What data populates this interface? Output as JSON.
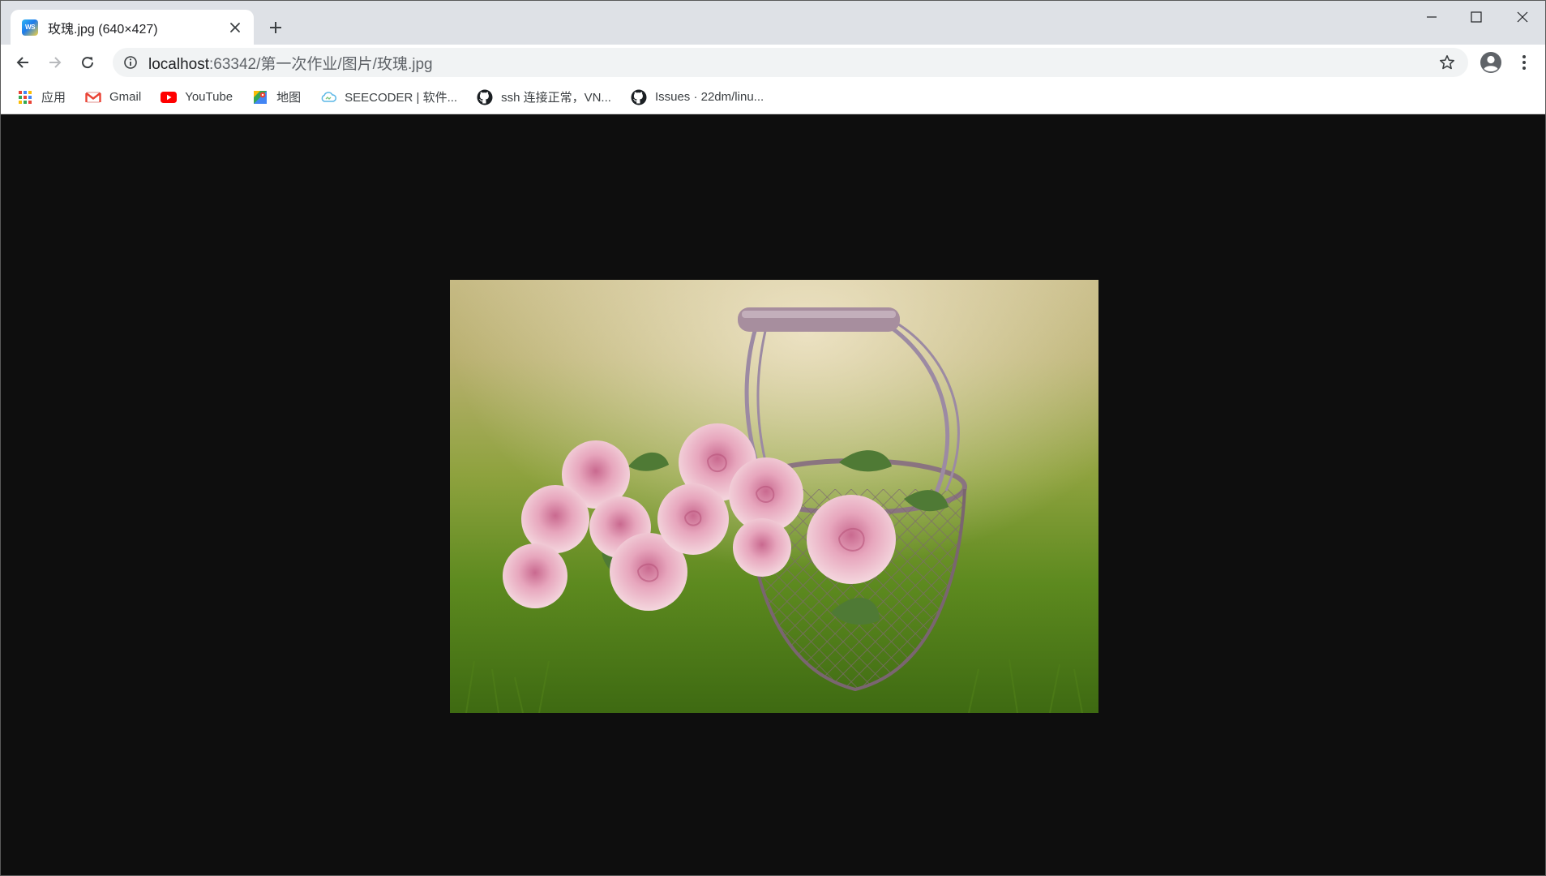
{
  "tab": {
    "title": "玫瑰.jpg (640×427)",
    "favicon": "webstorm-icon"
  },
  "address": {
    "host": "localhost",
    "rest": ":63342/第一次作业/图片/玫瑰.jpg"
  },
  "bookmarks": [
    {
      "label": "应用",
      "icon": "apps-grid-icon"
    },
    {
      "label": "Gmail",
      "icon": "gmail-icon"
    },
    {
      "label": "YouTube",
      "icon": "youtube-icon"
    },
    {
      "label": "地图",
      "icon": "maps-icon"
    },
    {
      "label": "SEECODER | 软件...",
      "icon": "seecoder-icon"
    },
    {
      "label": "ssh 连接正常，VN...",
      "icon": "github-icon"
    },
    {
      "label": "Issues · 22dm/linu...",
      "icon": "github-icon"
    }
  ],
  "image": {
    "alt": "玫瑰.jpg"
  },
  "colors": {
    "tabstrip": "#dee1e6",
    "page_background": "#0e0e0e",
    "omnibox": "#f1f3f4"
  }
}
